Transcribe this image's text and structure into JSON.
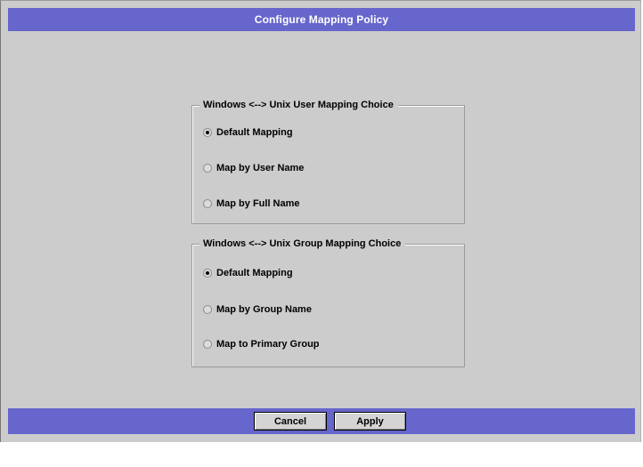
{
  "window": {
    "title": "Configure Mapping Policy"
  },
  "user_mapping": {
    "legend": "Windows <--> Unix User Mapping Choice",
    "options": [
      {
        "label": "Default Mapping",
        "selected": true
      },
      {
        "label": "Map by User Name",
        "selected": false
      },
      {
        "label": "Map by Full Name",
        "selected": false
      }
    ]
  },
  "group_mapping": {
    "legend": "Windows <--> Unix Group Mapping Choice",
    "options": [
      {
        "label": "Default Mapping",
        "selected": true
      },
      {
        "label": "Map by Group Name",
        "selected": false
      },
      {
        "label": "Map to Primary Group",
        "selected": false
      }
    ]
  },
  "buttons": {
    "cancel": "Cancel",
    "apply": "Apply"
  },
  "colors": {
    "title_bar": "#6666cc",
    "panel_background": "#cccccc"
  }
}
